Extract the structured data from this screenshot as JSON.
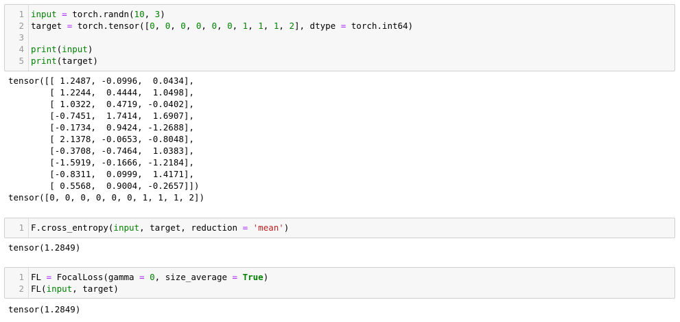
{
  "cells": [
    {
      "lines": [
        {
          "n": "1",
          "tokens": [
            [
              "b",
              "input"
            ],
            [
              "p",
              " "
            ],
            [
              "o",
              "="
            ],
            [
              "p",
              " torch.randn("
            ],
            [
              "n",
              "10"
            ],
            [
              "p",
              ", "
            ],
            [
              "n",
              "3"
            ],
            [
              "p",
              ")"
            ]
          ]
        },
        {
          "n": "2",
          "tokens": [
            [
              "p",
              "target "
            ],
            [
              "o",
              "="
            ],
            [
              "p",
              " torch.tensor(["
            ],
            [
              "n",
              "0"
            ],
            [
              "p",
              ", "
            ],
            [
              "n",
              "0"
            ],
            [
              "p",
              ", "
            ],
            [
              "n",
              "0"
            ],
            [
              "p",
              ", "
            ],
            [
              "n",
              "0"
            ],
            [
              "p",
              ", "
            ],
            [
              "n",
              "0"
            ],
            [
              "p",
              ", "
            ],
            [
              "n",
              "0"
            ],
            [
              "p",
              ", "
            ],
            [
              "n",
              "1"
            ],
            [
              "p",
              ", "
            ],
            [
              "n",
              "1"
            ],
            [
              "p",
              ", "
            ],
            [
              "n",
              "1"
            ],
            [
              "p",
              ", "
            ],
            [
              "n",
              "2"
            ],
            [
              "p",
              "], dtype "
            ],
            [
              "o",
              "="
            ],
            [
              "p",
              " torch.int64)"
            ]
          ]
        },
        {
          "n": "3",
          "tokens": []
        },
        {
          "n": "4",
          "tokens": [
            [
              "b",
              "print"
            ],
            [
              "p",
              "("
            ],
            [
              "b",
              "input"
            ],
            [
              "p",
              ")"
            ]
          ]
        },
        {
          "n": "5",
          "tokens": [
            [
              "b",
              "print"
            ],
            [
              "p",
              "(target)"
            ]
          ]
        }
      ],
      "output": "tensor([[ 1.2487, -0.0996,  0.0434],\n        [ 1.2244,  0.4444,  1.0498],\n        [ 1.0322,  0.4719, -0.0402],\n        [-0.7451,  1.7414,  1.6907],\n        [-0.1734,  0.9424, -1.2688],\n        [ 2.1378, -0.0653, -0.8048],\n        [-0.3708, -0.7464,  1.0383],\n        [-1.5919, -0.1666, -1.2184],\n        [-0.8311,  0.0999,  1.4171],\n        [ 0.5568,  0.9004, -0.2657]])\ntensor([0, 0, 0, 0, 0, 0, 1, 1, 1, 2])"
    },
    {
      "lines": [
        {
          "n": "1",
          "tokens": [
            [
              "p",
              "F.cross_entropy("
            ],
            [
              "b",
              "input"
            ],
            [
              "p",
              ", target, reduction "
            ],
            [
              "o",
              "="
            ],
            [
              "p",
              " "
            ],
            [
              "s",
              "'mean'"
            ],
            [
              "p",
              ")"
            ]
          ]
        }
      ],
      "output": "tensor(1.2849)"
    },
    {
      "lines": [
        {
          "n": "1",
          "tokens": [
            [
              "p",
              "FL "
            ],
            [
              "o",
              "="
            ],
            [
              "p",
              " FocalLoss(gamma "
            ],
            [
              "o",
              "="
            ],
            [
              "p",
              " "
            ],
            [
              "n",
              "0"
            ],
            [
              "p",
              ", size_average "
            ],
            [
              "o",
              "="
            ],
            [
              "p",
              " "
            ],
            [
              "k",
              "True"
            ],
            [
              "p",
              ")"
            ]
          ]
        },
        {
          "n": "2",
          "tokens": [
            [
              "p",
              "FL("
            ],
            [
              "b",
              "input"
            ],
            [
              "p",
              ", target)"
            ]
          ]
        }
      ],
      "output": "tensor(1.2849)"
    }
  ],
  "colors": {
    "builtin": "#008000",
    "operator": "#aa22ff",
    "number": "#008000",
    "string": "#ba2121",
    "keyword": "#008000",
    "line_number": "#999999",
    "cell_background": "#f7f7f7",
    "cell_border": "#cfcfcf"
  }
}
